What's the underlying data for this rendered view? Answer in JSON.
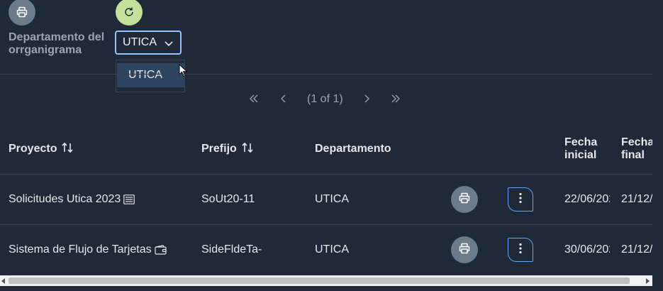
{
  "toolbar": {
    "print_icon": "printer-icon",
    "refresh_icon": "refresh-icon",
    "refresh_color": "#c5e09a"
  },
  "filter": {
    "label": "Departamento del orrganigrama",
    "label_line1": "Departamento del",
    "label_line2": "orrganigrama",
    "selected": "UTICA",
    "options": [
      "UTICA"
    ]
  },
  "pagination": {
    "first": "«",
    "prev": "‹",
    "status": "(1 of 1)",
    "next": "›",
    "last": "»"
  },
  "table": {
    "headers": {
      "proyecto": "Proyecto",
      "prefijo": "Prefijo",
      "departamento": "Departamento",
      "fecha_inicial_1": "Fecha",
      "fecha_inicial_2": "inicial",
      "fecha_final_1": "Fecha",
      "fecha_final_2": "final"
    },
    "rows": [
      {
        "proyecto": "Solicitudes Utica 2023",
        "proyecto_icon": "list-icon",
        "prefijo": "SoUt20-11",
        "departamento": "UTICA",
        "fecha_inicial": "22/06/202",
        "fecha_final": "21/12/"
      },
      {
        "proyecto": "Sistema de Flujo de Tarjetas",
        "proyecto_icon": "wallet-icon",
        "prefijo": "SideFldeTa-",
        "departamento": "UTICA",
        "fecha_inicial": "30/06/202",
        "fecha_final": "21/12/"
      }
    ]
  },
  "colors": {
    "background": "#1f2937",
    "accent_border": "#93c5fd",
    "print_button": "#6b7b8a",
    "dropdown_highlight": "#2d4560"
  }
}
